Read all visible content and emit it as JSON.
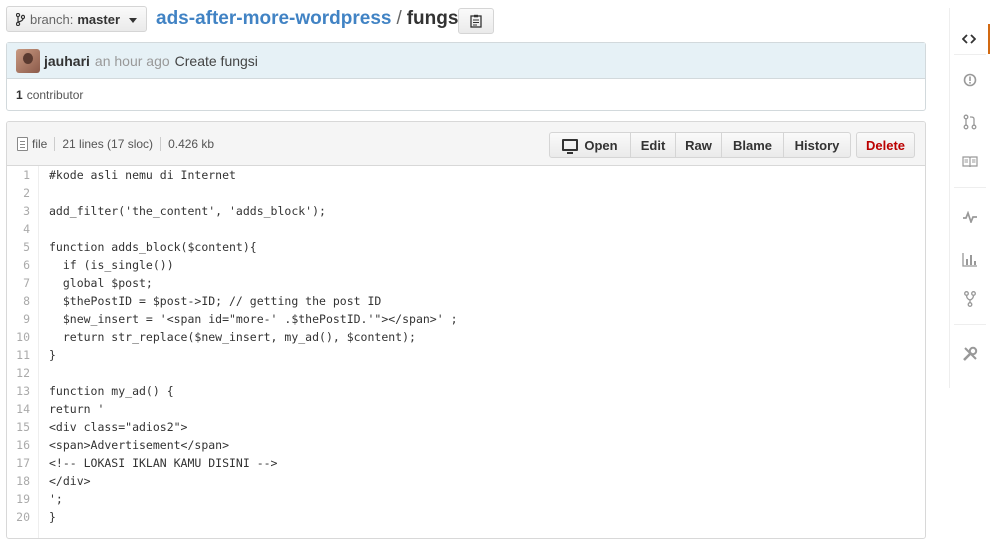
{
  "branch": {
    "label": "branch:",
    "value": "master"
  },
  "breadcrumb": {
    "repo": "ads-after-more-wordpress",
    "separator": "/",
    "file": "fungsi"
  },
  "commit": {
    "author": "jauhari",
    "time": "an hour ago",
    "message": "Create fungsi",
    "contributors_count": "1",
    "contributors_label": "contributor"
  },
  "file_info": {
    "type": "file",
    "lines": "21 lines (17 sloc)",
    "size": "0.426 kb"
  },
  "actions": {
    "open": "Open",
    "edit": "Edit",
    "raw": "Raw",
    "blame": "Blame",
    "history": "History",
    "delete": "Delete"
  },
  "code_lines": [
    {
      "n": "1",
      "text": "#kode asli nemu di Internet"
    },
    {
      "n": "2",
      "text": ""
    },
    {
      "n": "3",
      "text": "add_filter('the_content', 'adds_block');"
    },
    {
      "n": "4",
      "text": ""
    },
    {
      "n": "5",
      "text": "function adds_block($content){"
    },
    {
      "n": "6",
      "text": "  if (is_single())"
    },
    {
      "n": "7",
      "text": "  global $post;"
    },
    {
      "n": "8",
      "text": "  $thePostID = $post->ID; // getting the post ID"
    },
    {
      "n": "9",
      "text": "  $new_insert = '<span id=\"more-' .$thePostID.'\"></span>' ;"
    },
    {
      "n": "10",
      "text": "  return str_replace($new_insert, my_ad(), $content);"
    },
    {
      "n": "11",
      "text": "}"
    },
    {
      "n": "12",
      "text": ""
    },
    {
      "n": "13",
      "text": "function my_ad() {"
    },
    {
      "n": "14",
      "text": "return '"
    },
    {
      "n": "15",
      "text": "<div class=\"adios2\">"
    },
    {
      "n": "16",
      "text": "<span>Advertisement</span>"
    },
    {
      "n": "17",
      "text": "<!-- LOKASI IKLAN KAMU DISINI -->"
    },
    {
      "n": "18",
      "text": "</div>"
    },
    {
      "n": "19",
      "text": "';"
    },
    {
      "n": "20",
      "text": "}"
    }
  ],
  "sidebar": [
    "code-icon",
    "issues-icon",
    "pull-request-icon",
    "wiki-icon",
    "pulse-icon",
    "graphs-icon",
    "network-icon",
    "settings-icon"
  ],
  "colors": {
    "link": "#4183c4",
    "commit_bg": "#e6f1f6",
    "delete": "#bb0000",
    "active_tab": "#d26911"
  }
}
